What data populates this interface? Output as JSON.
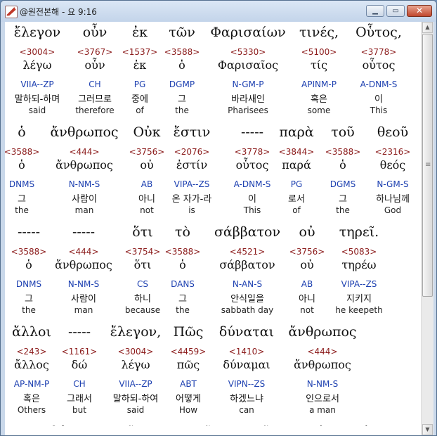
{
  "window": {
    "title": "@원전본해 - 요 9:16",
    "min_glyph": "▁",
    "max_glyph": "▭",
    "close_glyph": "✕"
  },
  "scrollbar": {
    "up": "▲",
    "down": "▼",
    "grip": "≡"
  },
  "blocks": [
    {
      "words": [
        {
          "g": "ἔλεγον",
          "n": "<3004>",
          "l": "λέγω",
          "p": "VIIA--ZP",
          "k": "말하되-하며",
          "e": "said"
        },
        {
          "g": "οὖν",
          "n": "<3767>",
          "l": "οὖν",
          "p": "CH",
          "k": "그러므로",
          "e": "therefore"
        },
        {
          "g": "ἐκ",
          "n": "<1537>",
          "l": "ἐκ",
          "p": "PG",
          "k": "중에",
          "e": "of"
        },
        {
          "g": "τῶν",
          "n": "<3588>",
          "l": "ὁ",
          "p": "DGMP",
          "k": "그",
          "e": "the"
        },
        {
          "g": "Φαρισαίων",
          "n": "<5330>",
          "l": "Φαρισαῖος",
          "p": "N-GM-P",
          "k": "바라새인",
          "e": "Pharisees"
        },
        {
          "g": "τινές,",
          "n": "<5100>",
          "l": "τίς",
          "p": "APINM-P",
          "k": "혹은",
          "e": "some"
        },
        {
          "g": "Οὗτος,",
          "n": "<3778>",
          "l": "οὗτος",
          "p": "A-DNM-S",
          "k": "이",
          "e": "This"
        }
      ]
    },
    {
      "words": [
        {
          "g": "ὁ",
          "n": "<3588>",
          "l": "ὁ",
          "p": "DNMS",
          "k": "그",
          "e": "the"
        },
        {
          "g": "ἄνθρωπος",
          "n": "<444>",
          "l": "ἄνθρωπος",
          "p": "N-NM-S",
          "k": "사람이",
          "e": "man"
        },
        {
          "g": "Οὐκ",
          "n": "<3756>",
          "l": "οὐ",
          "p": "AB",
          "k": "아니",
          "e": "not"
        },
        {
          "g": "ἔστιν",
          "n": "<2076>",
          "l": "ἐστίν",
          "p": "VIPA--ZS",
          "k": "온 자가-라",
          "e": "is"
        },
        {
          "g": "-----",
          "n": "<3778>",
          "l": "οὗτος",
          "p": "A-DNM-S",
          "k": "이",
          "e": "This"
        },
        {
          "g": "παρὰ",
          "n": "<3844>",
          "l": "παρά",
          "p": "PG",
          "k": "로서",
          "e": "of"
        },
        {
          "g": "τοῦ",
          "n": "<3588>",
          "l": "ὁ",
          "p": "DGMS",
          "k": "그",
          "e": "the"
        },
        {
          "g": "θεοῦ",
          "n": "<2316>",
          "l": "θεός",
          "p": "N-GM-S",
          "k": "하나님께",
          "e": "God"
        }
      ]
    },
    {
      "words": [
        {
          "g": "-----",
          "n": "<3588>",
          "l": "ὁ",
          "p": "DNMS",
          "k": "그",
          "e": "the"
        },
        {
          "g": "-----",
          "n": "<444>",
          "l": "ἄνθρωπος",
          "p": "N-NM-S",
          "k": "사람이",
          "e": "man"
        },
        {
          "g": "ὅτι",
          "n": "<3754>",
          "l": "ὅτι",
          "p": "CS",
          "k": "하니",
          "e": "because"
        },
        {
          "g": "τὸ",
          "n": "<3588>",
          "l": "ὁ",
          "p": "DANS",
          "k": "그",
          "e": "the"
        },
        {
          "g": "σάββατον",
          "n": "<4521>",
          "l": "σάββατον",
          "p": "N-AN-S",
          "k": "안식일을",
          "e": "sabbath day"
        },
        {
          "g": "οὐ",
          "n": "<3756>",
          "l": "οὐ",
          "p": "AB",
          "k": "아니",
          "e": "not"
        },
        {
          "g": "τηρεῖ.",
          "n": "<5083>",
          "l": "τηρέω",
          "p": "VIPA--ZS",
          "k": "지키지",
          "e": "he keepeth"
        }
      ]
    },
    {
      "words": [
        {
          "g": "ἄλλοι",
          "n": "<243>",
          "l": "ἄλλος",
          "p": "AP-NM-P",
          "k": "혹은",
          "e": "Others"
        },
        {
          "g": "-----",
          "n": "<1161>",
          "l": "δώ",
          "p": "CH",
          "k": "그래서",
          "e": "but"
        },
        {
          "g": "ἔλεγον,",
          "n": "<3004>",
          "l": "λέγω",
          "p": "VIIA--ZP",
          "k": "말하되-하여",
          "e": "said"
        },
        {
          "g": "Πῶς",
          "n": "<4459>",
          "l": "πῶς",
          "p": "ABT",
          "k": "어떻게",
          "e": "How"
        },
        {
          "g": "δύναται",
          "n": "<1410>",
          "l": "δύναμαι",
          "p": "VIPN--ZS",
          "k": "하겠느냐",
          "e": "can"
        },
        {
          "g": "ἄνθρωπος",
          "n": "<444>",
          "l": "ἄνθρωπος",
          "p": "N-NM-S",
          "k": "인으로서",
          "e": "a man"
        }
      ]
    },
    {
      "words": [
        {
          "g": "ἁμαρτωλὸς",
          "n": "",
          "l": "",
          "p": "",
          "k": "",
          "e": ""
        },
        {
          "g": "τοιαῦτα",
          "n": "",
          "l": "",
          "p": "",
          "k": "",
          "e": ""
        },
        {
          "g": "σημεῖα",
          "n": "",
          "l": "",
          "p": "",
          "k": "",
          "e": ""
        },
        {
          "g": "ποιεῖν;",
          "n": "",
          "l": "",
          "p": "",
          "k": "",
          "e": ""
        },
        {
          "g": "καὶ",
          "n": "",
          "l": "",
          "p": "",
          "k": "",
          "e": ""
        },
        {
          "g": "σχίσμα",
          "n": "",
          "l": "",
          "p": "",
          "k": "",
          "e": ""
        }
      ]
    }
  ]
}
